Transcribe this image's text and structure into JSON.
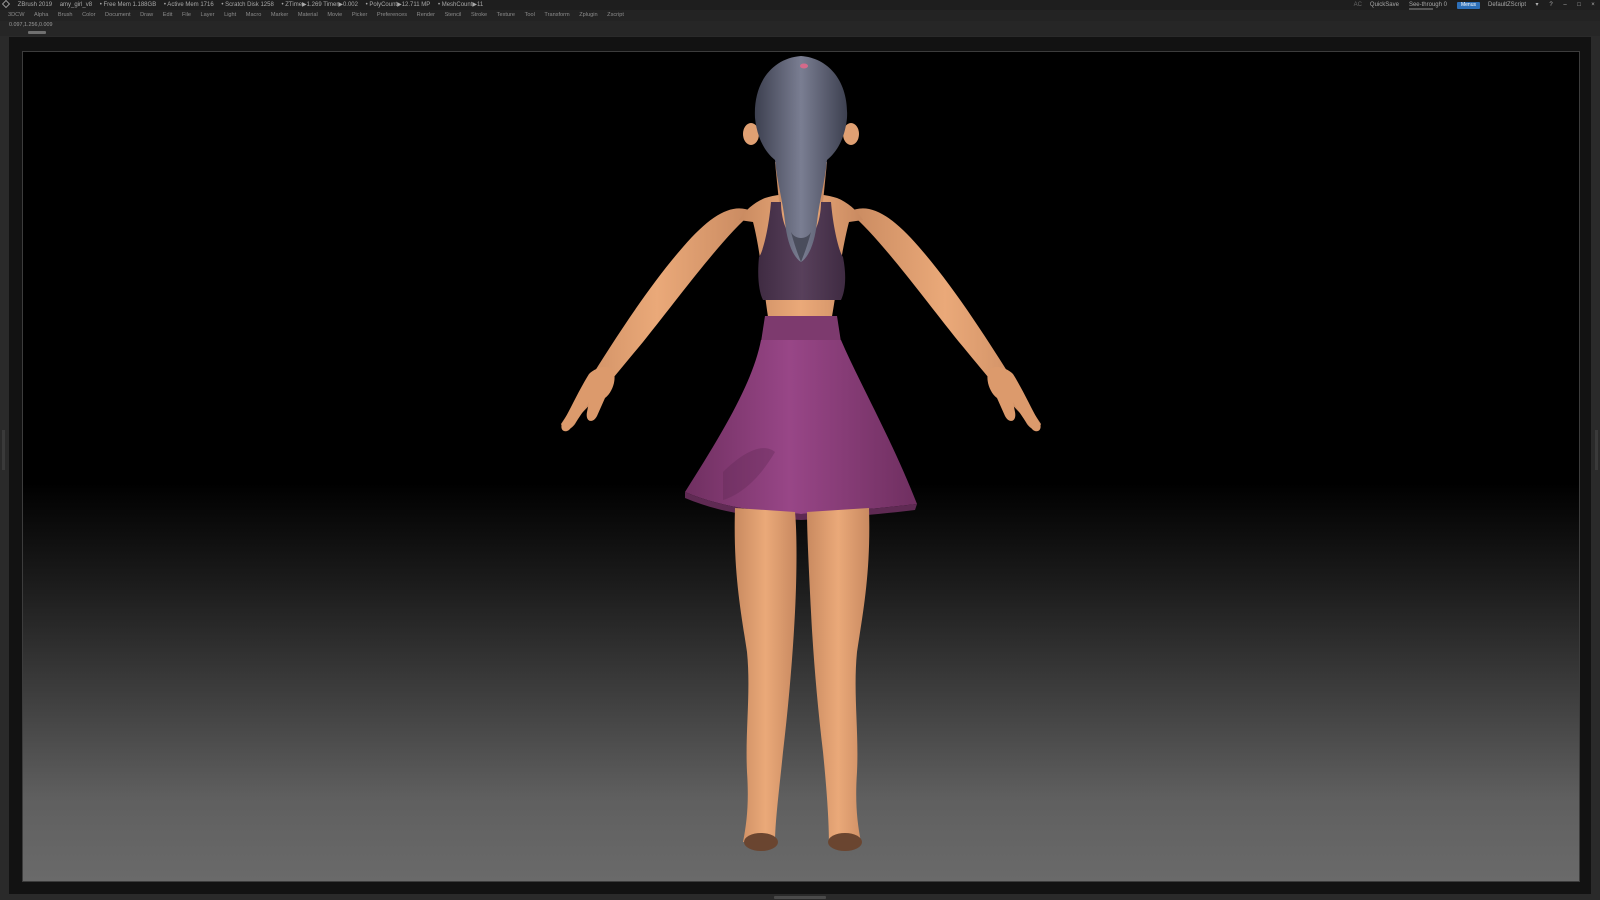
{
  "titlebar": {
    "app": "ZBrush 2019",
    "file": "amy_girl_v8",
    "free_mem": "• Free Mem 1.188GB",
    "active_mem": "• Active Mem 1716",
    "scratch": "• Scratch Disk 1258",
    "ztime": "• ZTime▶1.269 Timer▶0.002",
    "polycount": "• PolyCount▶12.711 MP",
    "meshcount": "• MeshCount▶11",
    "ac": "AC",
    "quicksave": "QuickSave",
    "seethrough": "See-through 0",
    "menus": "Menus",
    "script": "DefaultZScript"
  },
  "menus": [
    "3DCW",
    "Alpha",
    "Brush",
    "Color",
    "Document",
    "Draw",
    "Edit",
    "File",
    "Layer",
    "Light",
    "Macro",
    "Marker",
    "Material",
    "Movie",
    "Picker",
    "Preferences",
    "Render",
    "Stencil",
    "Stroke",
    "Texture",
    "Tool",
    "Transform",
    "Zplugin",
    "Zscript"
  ],
  "info": {
    "coords": "0.097,1.256,0.009"
  },
  "icons": [
    "zbrush-logo-icon",
    "layout-icon",
    "help-icon",
    "minimize-icon",
    "maximize-icon",
    "close-icon"
  ],
  "colors": {
    "skin": "#e6a375",
    "top": "#4e3650",
    "skirt": "#8a3f78",
    "hair": "#5e6272",
    "accent": "#2d6fb8"
  }
}
